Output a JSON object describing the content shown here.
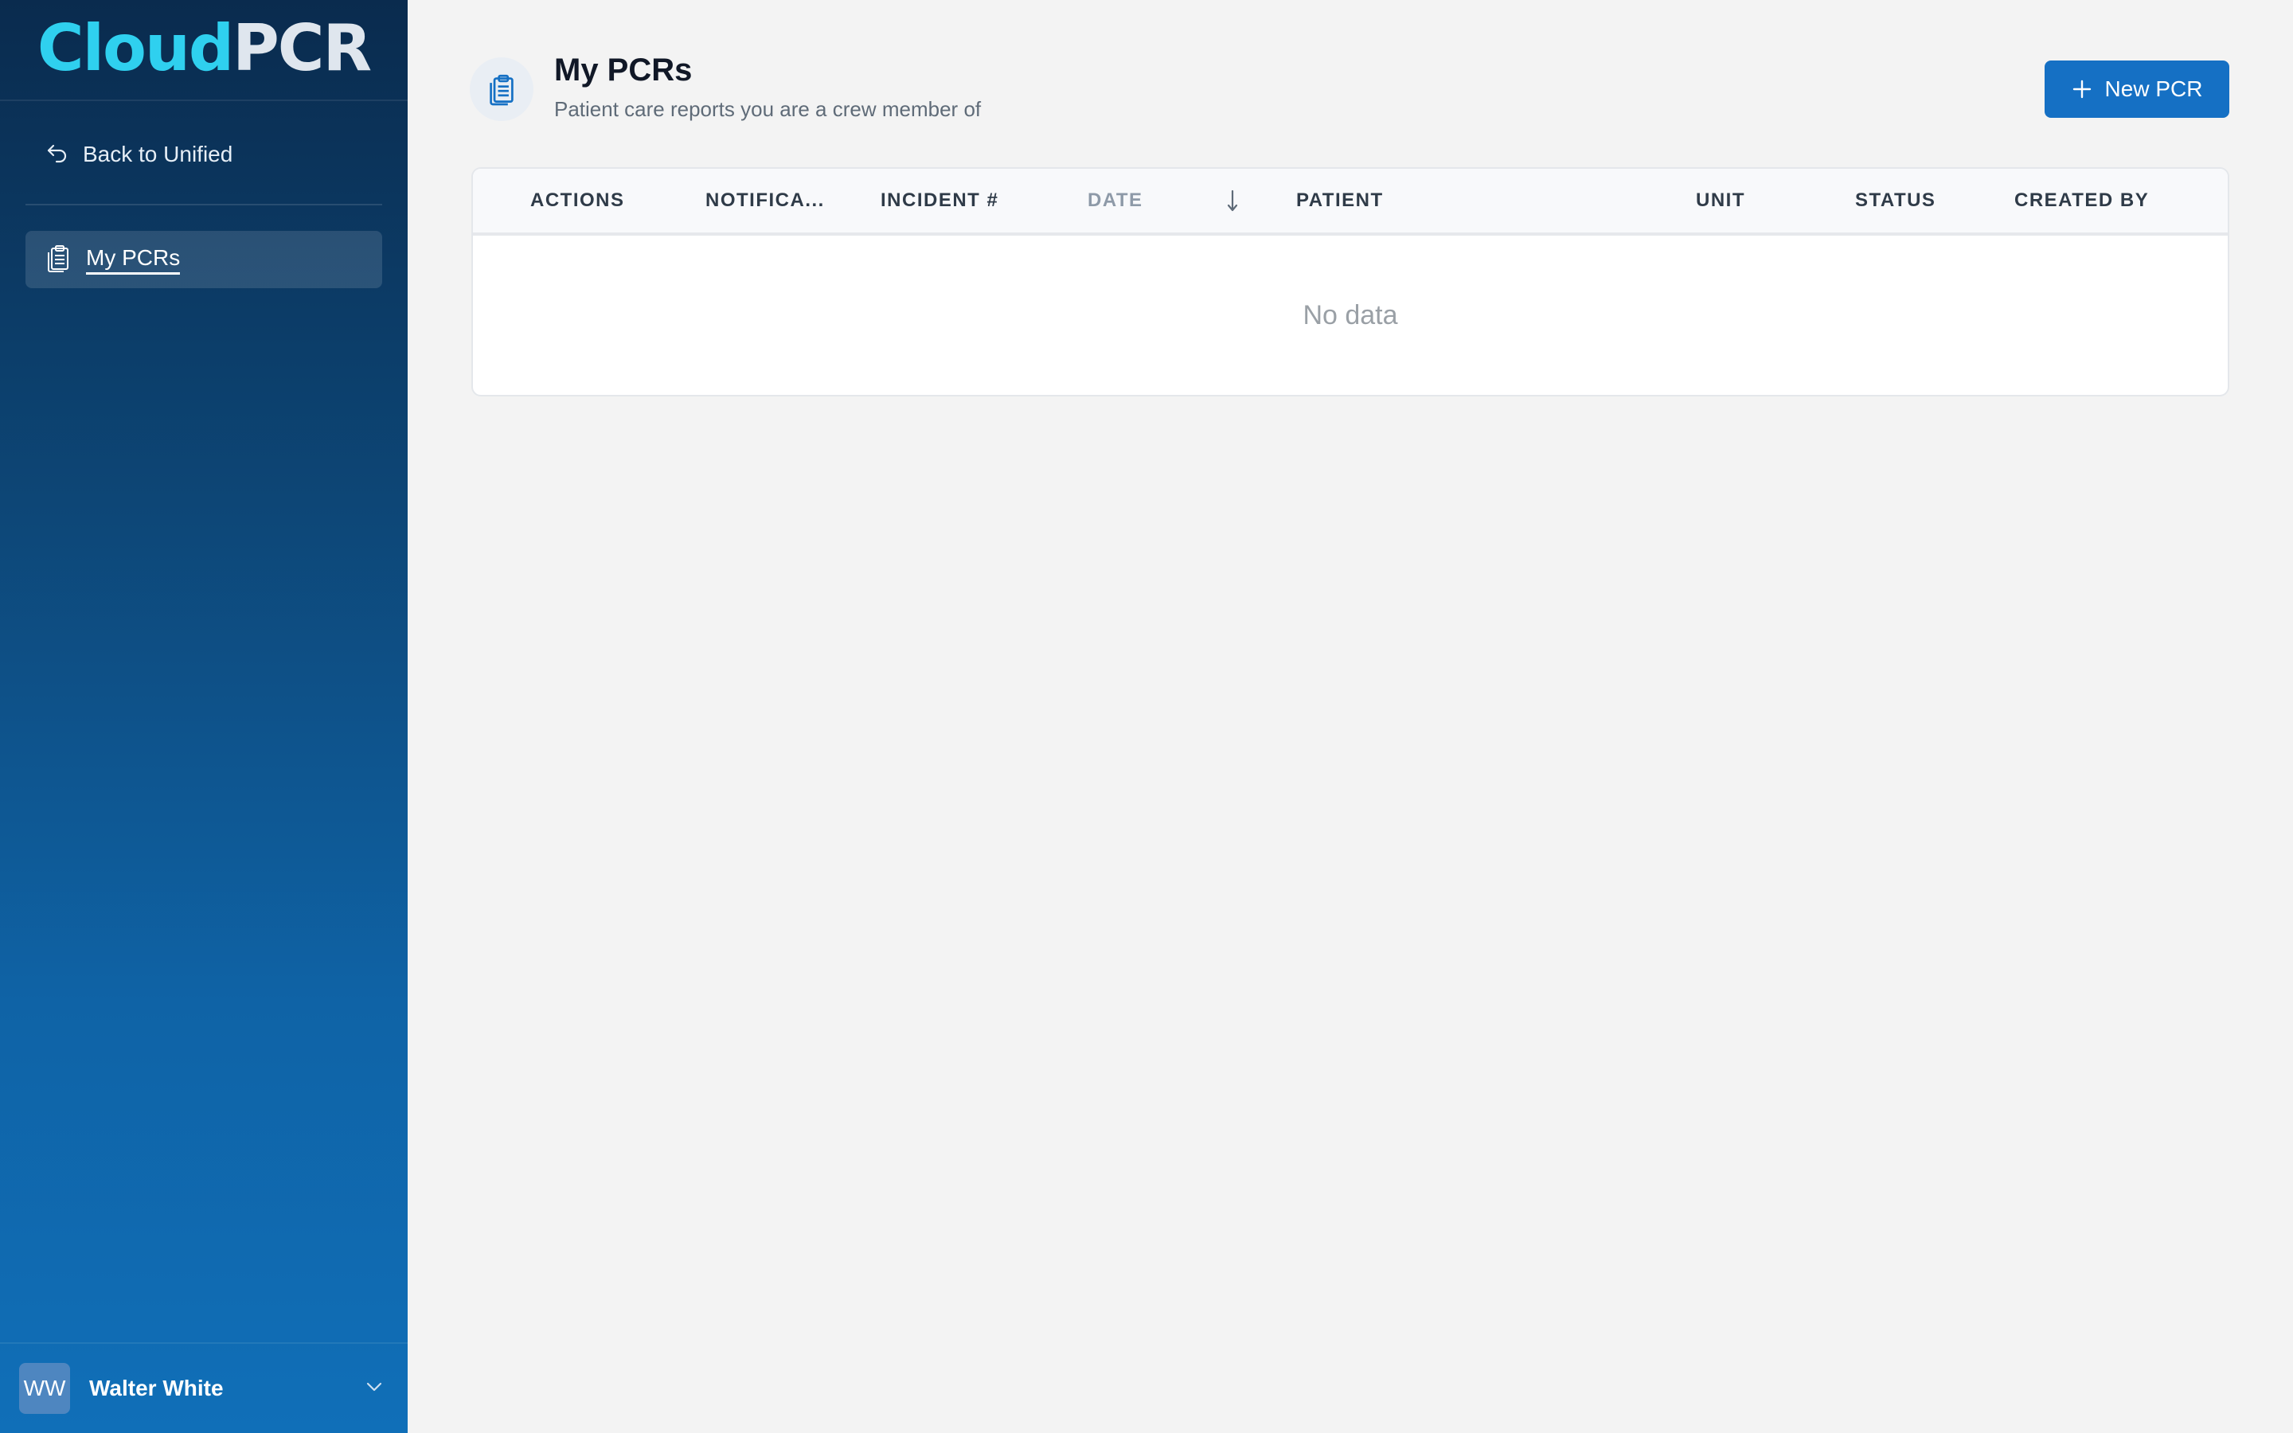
{
  "sidebar": {
    "logo_part1": "Cloud",
    "logo_part2": "PCR",
    "back_label": "Back to Unified",
    "nav_items": [
      {
        "label": "My PCRs",
        "icon": "clipboard-icon",
        "active": true
      }
    ],
    "user": {
      "initials": "WW",
      "name": "Walter White"
    }
  },
  "header": {
    "title": "My PCRs",
    "subtitle": "Patient care reports you are a crew member of",
    "new_button_label": "New PCR"
  },
  "table": {
    "columns": [
      "ACTIONS",
      "NOTIFICA...",
      "INCIDENT #",
      "DATE",
      "PATIENT",
      "UNIT",
      "STATUS",
      "CREATED BY"
    ],
    "sorted_column": "DATE",
    "sort_direction": "descending",
    "rows": [],
    "empty_text": "No data"
  },
  "colors": {
    "sidebar_top": "#0a2b4e",
    "sidebar_bottom": "#106fb8",
    "logo_cloud": "#2fd0ef",
    "primary_button": "#1570c4",
    "page_background": "#f3f3f3"
  }
}
